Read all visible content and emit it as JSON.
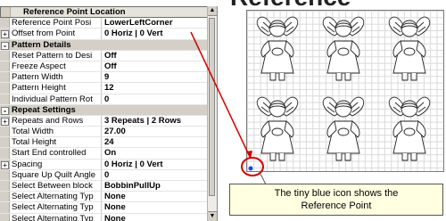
{
  "header_text": "Reference Point",
  "property_grid": {
    "rows": [
      {
        "type": "category",
        "label": "Reference Point Location",
        "expander": ""
      },
      {
        "type": "prop",
        "name": "Reference Point Posi",
        "value": "LowerLeftCorner",
        "expander": ""
      },
      {
        "type": "prop",
        "name": "Offset from Point",
        "value": "0 Horiz | 0 Vert",
        "expander": "+"
      },
      {
        "type": "category",
        "label": "Pattern Details",
        "expander": "-"
      },
      {
        "type": "prop",
        "name": "Reset Pattern to Desi",
        "value": "Off",
        "expander": ""
      },
      {
        "type": "prop",
        "name": "Freeze Aspect",
        "value": "Off",
        "expander": ""
      },
      {
        "type": "prop",
        "name": "Pattern Width",
        "value": "9",
        "expander": ""
      },
      {
        "type": "prop",
        "name": "Pattern Height",
        "value": "12",
        "expander": ""
      },
      {
        "type": "prop",
        "name": "Individual Pattern Rot",
        "value": "0",
        "expander": ""
      },
      {
        "type": "category",
        "label": "Repeat Settings",
        "expander": "-"
      },
      {
        "type": "prop",
        "name": "Repeats and Rows",
        "value": "3 Repeats | 2 Rows",
        "expander": "+"
      },
      {
        "type": "prop",
        "name": "Total Width",
        "value": "27.00",
        "expander": ""
      },
      {
        "type": "prop",
        "name": "Total Height",
        "value": "24",
        "expander": ""
      },
      {
        "type": "prop",
        "name": "Start End controlled",
        "value": "On",
        "expander": ""
      },
      {
        "type": "prop",
        "name": "Spacing",
        "value": "0 Horiz | 0 Vert",
        "expander": "+"
      },
      {
        "type": "prop",
        "name": "Square Up Quilt Angle",
        "value": "0",
        "expander": ""
      },
      {
        "type": "prop",
        "name": "Select Between block",
        "value": "BobbinPullUp",
        "expander": ""
      },
      {
        "type": "prop",
        "name": "Select Alternating Typ",
        "value": "None",
        "expander": ""
      },
      {
        "type": "prop",
        "name": "Select Alternating Typ",
        "value": "None",
        "expander": ""
      },
      {
        "type": "prop",
        "name": "Select Alternating Typ",
        "value": "None",
        "expander": ""
      }
    ]
  },
  "callout": {
    "line1": "The tiny blue icon shows the",
    "line2": "Reference Point"
  },
  "colors": {
    "arrow": "#d40000",
    "grid_bg": "#d4d0c8",
    "callout_bg": "#ffffe1"
  }
}
